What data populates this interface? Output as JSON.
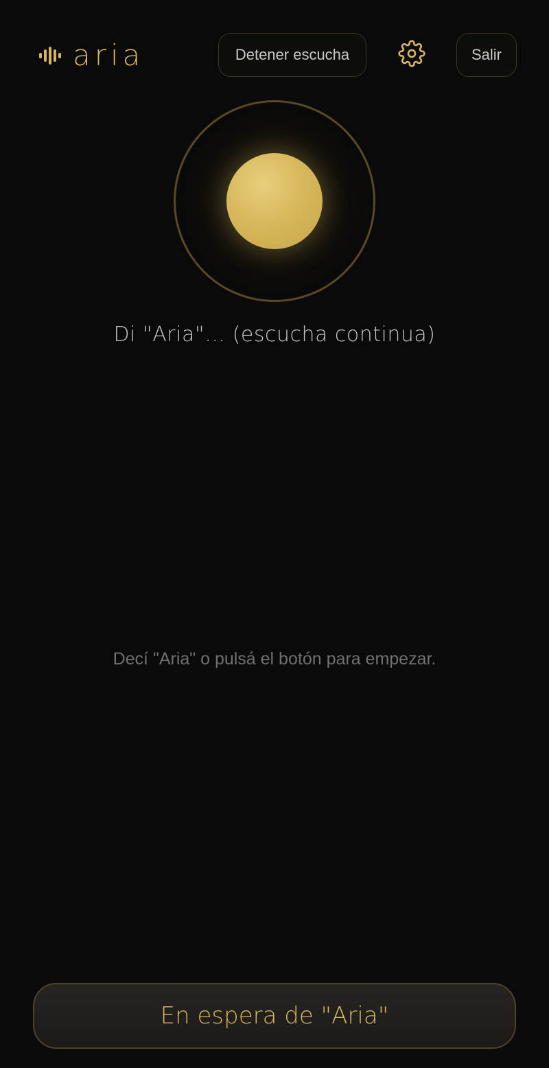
{
  "header": {
    "brand_name": "aria",
    "stop_listening_label": "Detener escucha",
    "exit_label": "Salir"
  },
  "icons": {
    "brand": "waveform-icon",
    "settings": "gear-icon"
  },
  "main": {
    "status": "Di \"Aria\"… (escucha continua)",
    "hint": "Decí \"Aria\" o pulsá el botón para empezar."
  },
  "footer": {
    "wake_button_label": "En espera de \"Aria\""
  },
  "colors": {
    "accent": "#d8b55a",
    "background": "#0a0a0a",
    "ring": "#5a4a22"
  }
}
